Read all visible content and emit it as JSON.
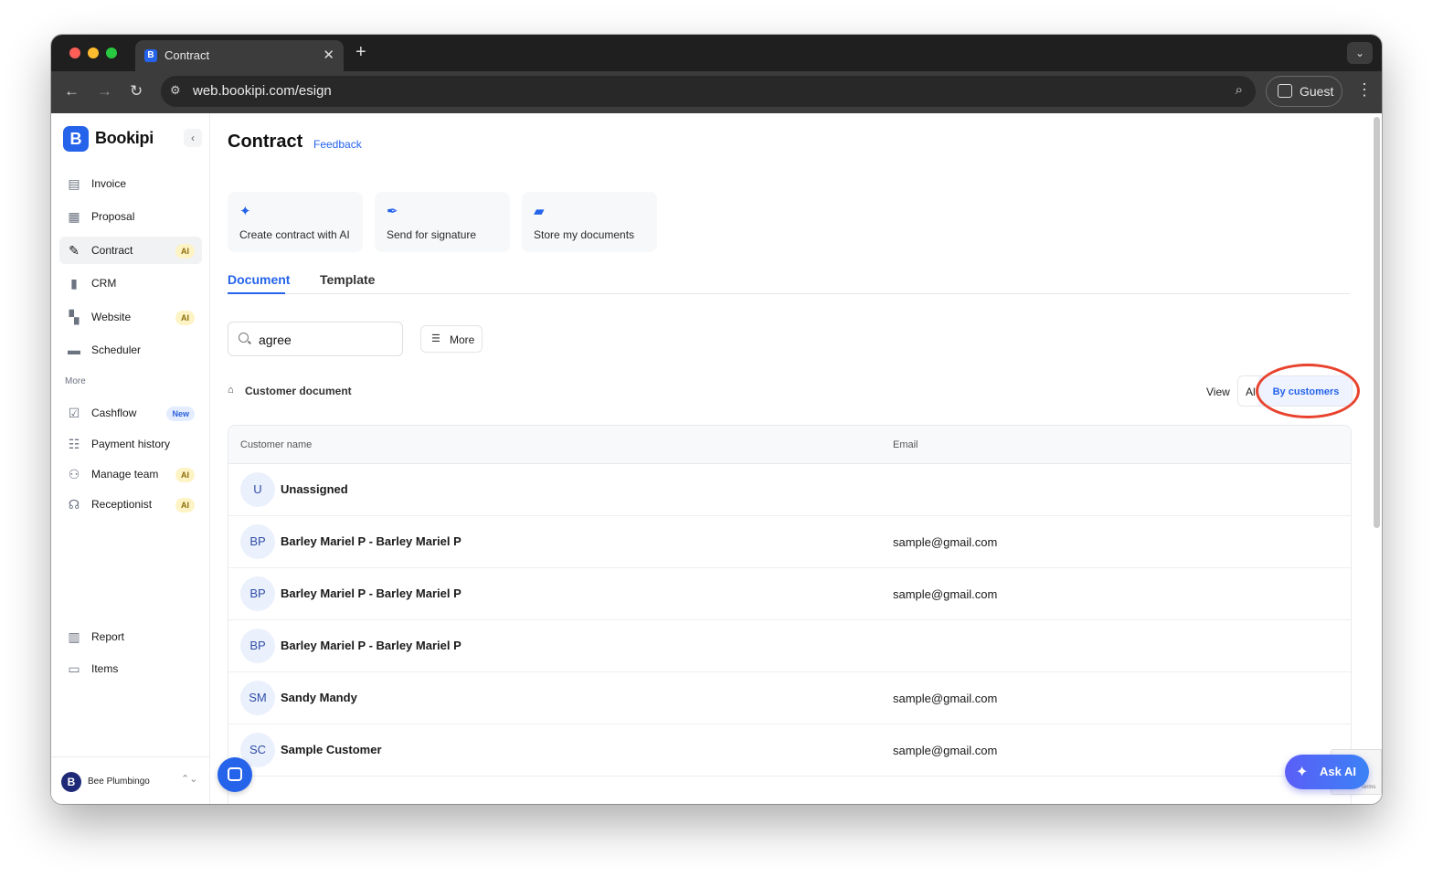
{
  "browser": {
    "tab_title": "Contract",
    "url": "web.bookipi.com/esign",
    "profile_label": "Guest"
  },
  "sidebar": {
    "logo_text": "Bookipi",
    "items": [
      {
        "label": "Invoice",
        "icon": "invoice-icon"
      },
      {
        "label": "Proposal",
        "icon": "proposal-icon"
      },
      {
        "label": "Contract",
        "icon": "contract-icon",
        "badge": "AI",
        "active": true
      },
      {
        "label": "CRM",
        "icon": "crm-icon"
      },
      {
        "label": "Website",
        "icon": "website-icon",
        "badge": "AI"
      },
      {
        "label": "Scheduler",
        "icon": "scheduler-icon"
      }
    ],
    "more_label": "More",
    "more_items": [
      {
        "label": "Cashflow",
        "icon": "cashflow-icon",
        "badge": "New"
      },
      {
        "label": "Payment history",
        "icon": "payment-history-icon"
      },
      {
        "label": "Manage team",
        "icon": "team-icon",
        "badge": "AI"
      },
      {
        "label": "Receptionist",
        "icon": "headset-icon",
        "badge": "AI"
      }
    ],
    "bottom_items": [
      {
        "label": "Report",
        "icon": "report-icon"
      },
      {
        "label": "Items",
        "icon": "items-icon"
      }
    ],
    "account_name": "Bee Plumbingo"
  },
  "main": {
    "title": "Contract",
    "feedback_label": "Feedback",
    "actions": [
      {
        "label": "Create contract with AI",
        "icon": "sparkle-icon"
      },
      {
        "label": "Send for signature",
        "icon": "pen-icon"
      },
      {
        "label": "Store my documents",
        "icon": "folder-icon"
      }
    ],
    "tabs": [
      {
        "label": "Document",
        "active": true
      },
      {
        "label": "Template"
      }
    ],
    "search": {
      "value": "agree"
    },
    "more_label": "More",
    "section_title": "Customer document",
    "view_label": "View",
    "view_options": {
      "all": "Al",
      "by_customers": "By customers",
      "selected": "By customers"
    },
    "table": {
      "columns": [
        "Customer name",
        "Email"
      ],
      "rows": [
        {
          "initials": "U",
          "name": "Unassigned",
          "email": ""
        },
        {
          "initials": "BP",
          "name": "Barley Mariel P - Barley Mariel P",
          "email": "sample@gmail.com"
        },
        {
          "initials": "BP",
          "name": "Barley Mariel P - Barley Mariel P",
          "email": "sample@gmail.com"
        },
        {
          "initials": "BP",
          "name": "Barley Mariel P - Barley Mariel P",
          "email": ""
        },
        {
          "initials": "SM",
          "name": "Sandy Mandy",
          "email": "sample@gmail.com"
        },
        {
          "initials": "SC",
          "name": "Sample Customer",
          "email": "sample@gmail.com"
        }
      ]
    },
    "ask_ai_label": "Ask AI",
    "recaptcha_text": "Terms"
  },
  "colors": {
    "accent": "#2563eb",
    "highlight": "#e8432e",
    "badge_ai_bg": "#fdf3c4",
    "badge_new_bg": "#e3edff"
  }
}
